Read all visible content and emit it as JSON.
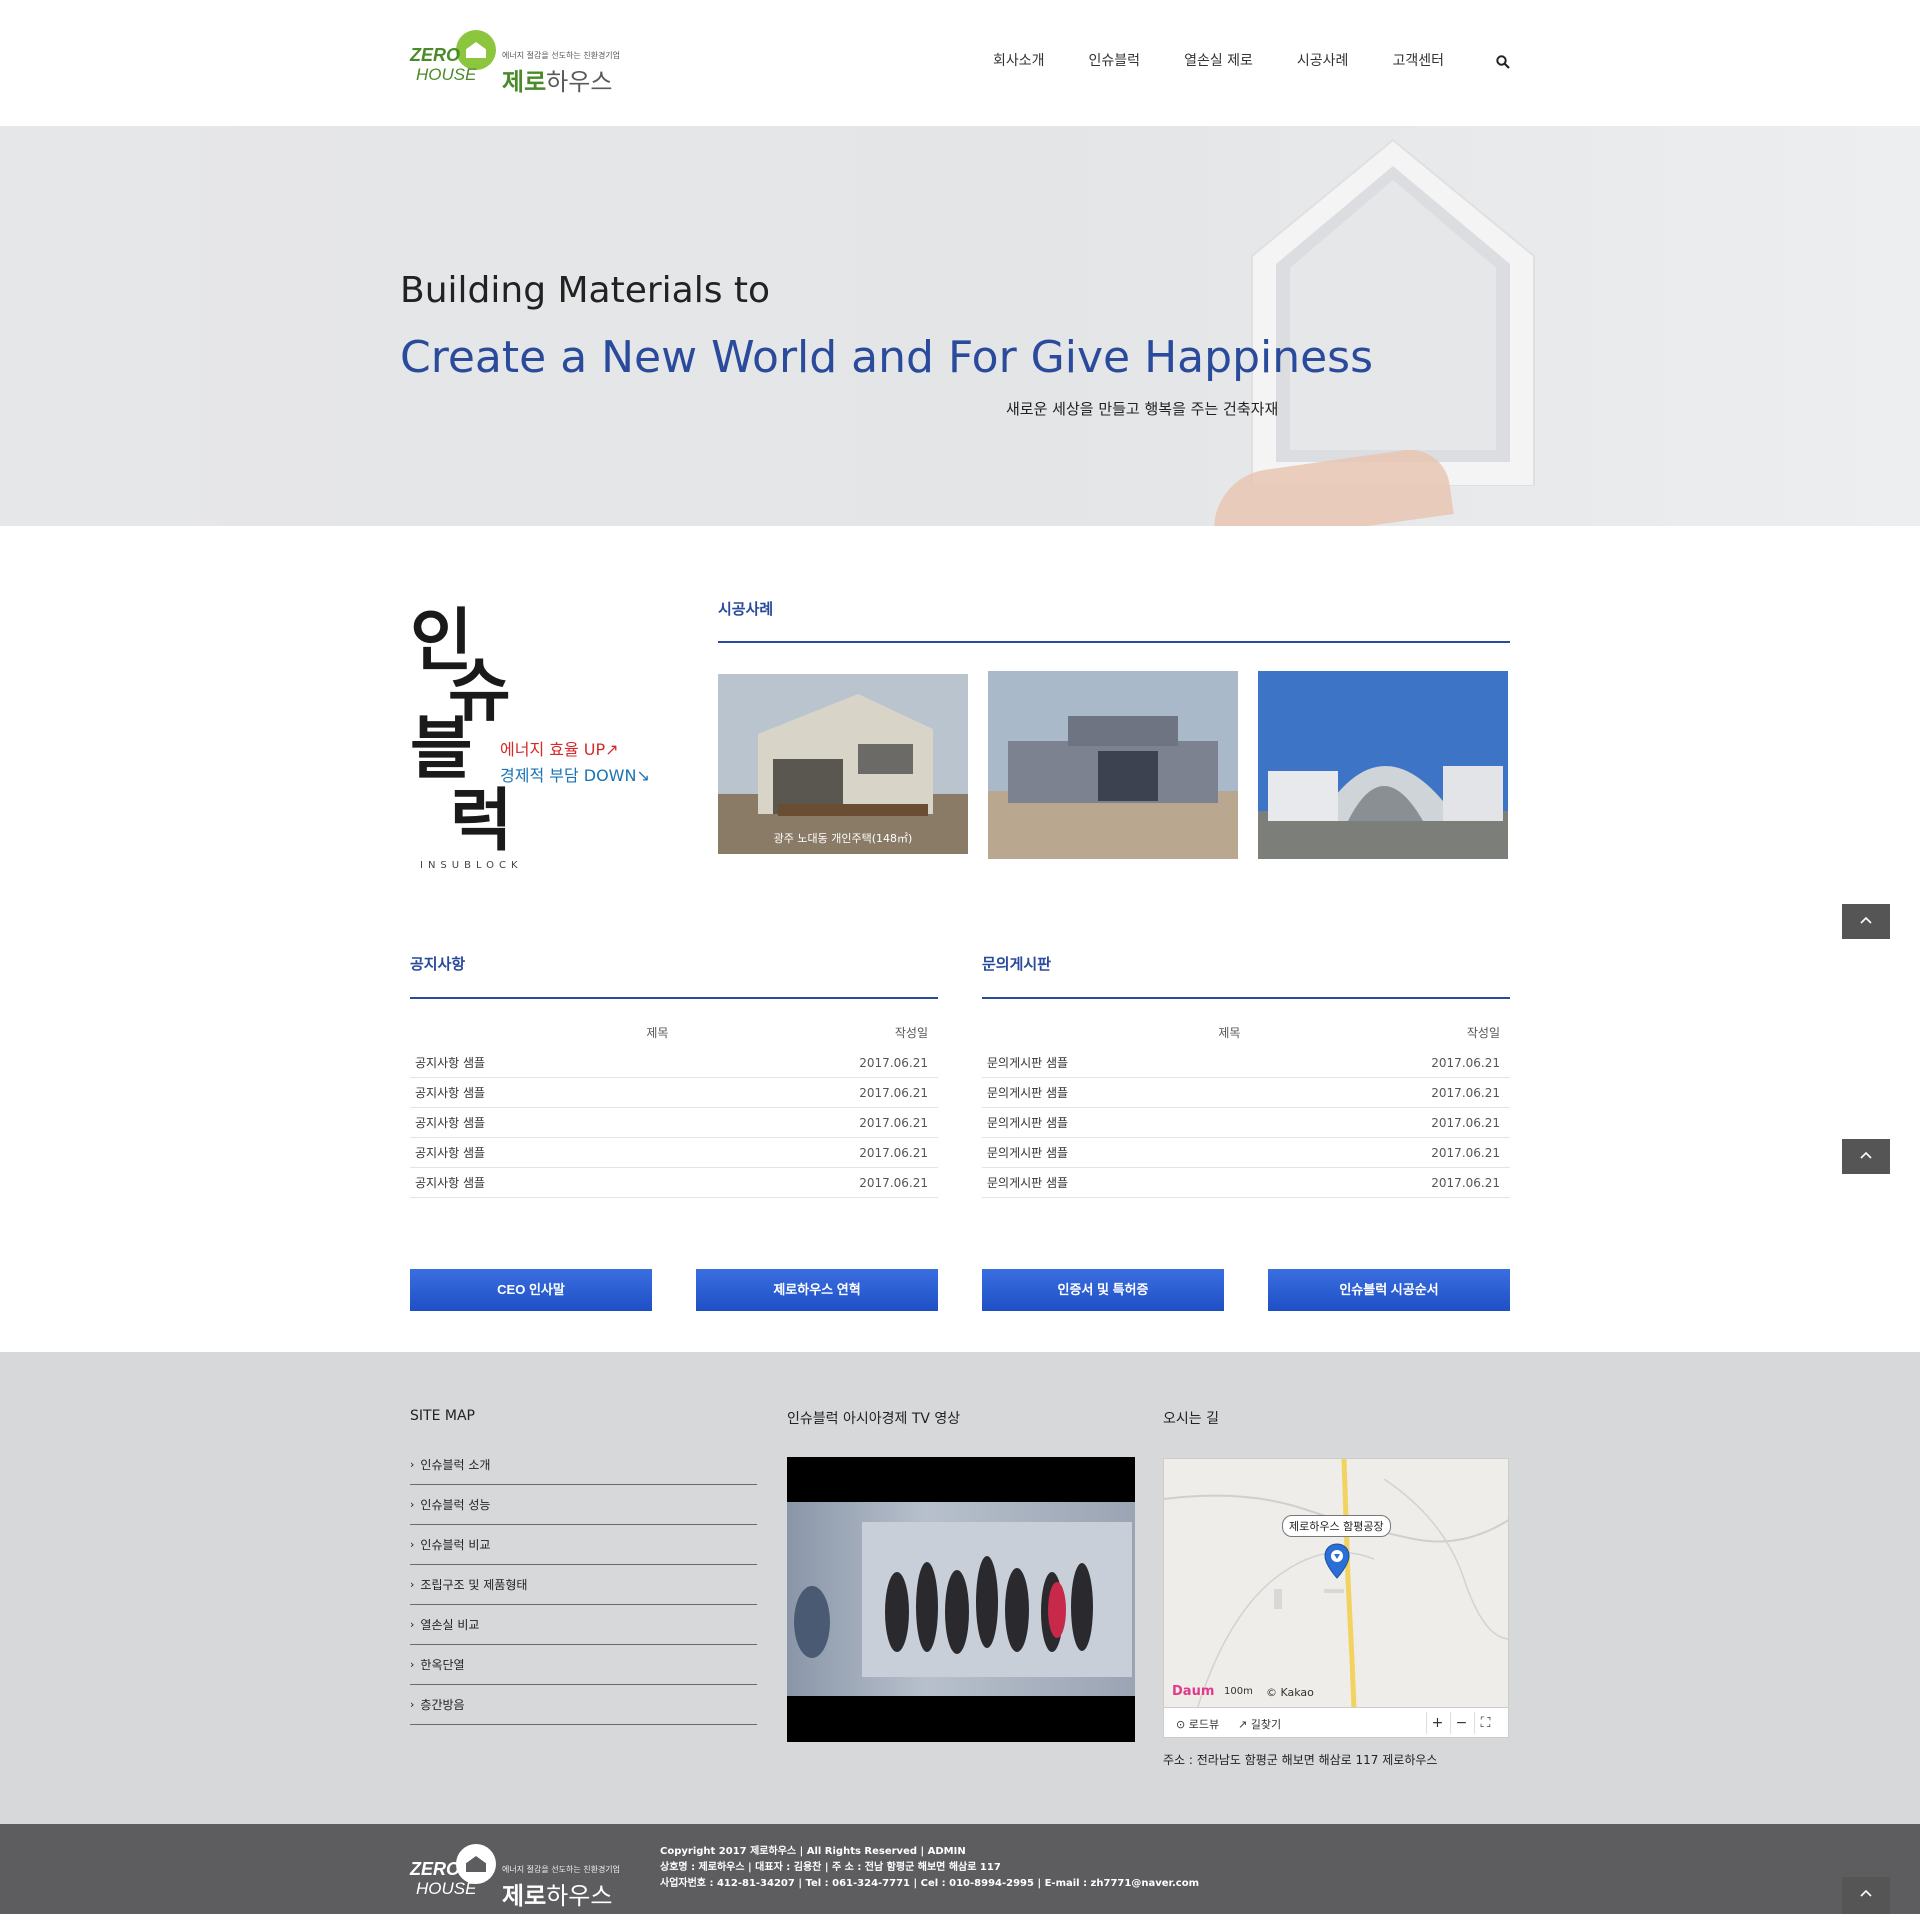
{
  "header": {
    "logo": {
      "zero": "ZERO",
      "house": "HOUSE",
      "tagline": "에너지 절감을 선도하는 친환경기업",
      "name_a": "제로",
      "name_b": "하우스"
    },
    "nav": [
      "회사소개",
      "인슈블럭",
      "열손실 제로",
      "시공사례",
      "고객센터"
    ],
    "search_icon": "search-icon"
  },
  "hero": {
    "line1": "Building Materials to",
    "line2": "Create a New World and For Give Happiness",
    "sub": "새로운 세상을 만들고 행복을 주는 건축자재"
  },
  "insublock": {
    "big1": "인",
    "big2": "슈",
    "big3": "블",
    "big4": "럭",
    "up_text": "에너지 효율 UP↗",
    "down_text": "경제적 부담 DOWN↘",
    "english": "INSUBLOCK"
  },
  "cases": {
    "title": "시공사례",
    "items": [
      {
        "caption": "광주 노대동 개인주택(148㎡)"
      },
      {
        "caption": ""
      },
      {
        "caption": ""
      }
    ]
  },
  "notice": {
    "title": "공지사항",
    "col_title": "제목",
    "col_date": "작성일",
    "rows": [
      {
        "title": "공지사항 샘플",
        "date": "2017.06.21"
      },
      {
        "title": "공지사항 샘플",
        "date": "2017.06.21"
      },
      {
        "title": "공지사항 샘플",
        "date": "2017.06.21"
      },
      {
        "title": "공지사항 샘플",
        "date": "2017.06.21"
      },
      {
        "title": "공지사항 샘플",
        "date": "2017.06.21"
      }
    ]
  },
  "qna": {
    "title": "문의게시판",
    "col_title": "제목",
    "col_date": "작성일",
    "rows": [
      {
        "title": "문의게시판 샘플",
        "date": "2017.06.21"
      },
      {
        "title": "문의게시판 샘플",
        "date": "2017.06.21"
      },
      {
        "title": "문의게시판 샘플",
        "date": "2017.06.21"
      },
      {
        "title": "문의게시판 샘플",
        "date": "2017.06.21"
      },
      {
        "title": "문의게시판 샘플",
        "date": "2017.06.21"
      }
    ]
  },
  "buttons": [
    "CEO 인사말",
    "제로하우스 연혁",
    "인증서 및 특허증",
    "인슈블럭 시공순서"
  ],
  "footer": {
    "sitemap_title": "SITE MAP",
    "sitemap": [
      "인슈블럭 소개",
      "인슈블럭 성능",
      "인슈블럭 비교",
      "조립구조 및 제품형태",
      "열손실 비교",
      "한옥단열",
      "층간방음"
    ],
    "video_title": "인슈블럭 아시아경제 TV 영상",
    "map_title": "오시는 길",
    "map_label": "제로하우스 함평공장",
    "map_scale": "100m",
    "map_copyright": "© Kakao",
    "map_logo": "Daum",
    "map_roadview": "로드뷰",
    "map_route": "길찾기",
    "address": "주소 : 전라남도 함평군 해보면 해삼로 117 제로하우스"
  },
  "bottom": {
    "line1": "Copyright 2017 제로하우스 | All Rights Reserved | ADMIN",
    "line2": "상호명 : 제로하우스 | 대표자 : 김용찬 | 주 소 : 전남 함평군 해보면 해삼로 117",
    "line3": "사업자번호 : 412-81-34207 | Tel : 061-324-7771 | Cel : 010-8994-2995 | E-mail : zh7771@naver.com"
  },
  "colors": {
    "brand_blue": "#2a4a9c",
    "brand_green": "#4a8a2a",
    "button_blue": "#2a5bd7"
  }
}
